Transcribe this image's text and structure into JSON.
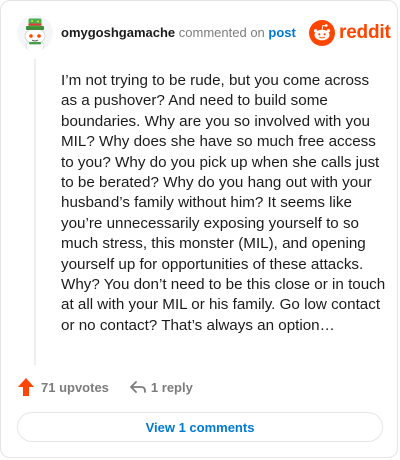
{
  "header": {
    "username": "omygoshgamache",
    "action": "commented on",
    "post_link": "post",
    "brand": "reddit"
  },
  "comment": {
    "body": "I’m not trying to be rude, but you come across as a pushover? And need to build some boundaries. Why are you so involved with you MIL? Why does she have so much free access to you? Why do you pick up when she calls just to be berated? Why do you hang out with your husband’s family without him? It seems like you’re unnecessarily exposing yourself to so much stress, this monster (MIL), and opening yourself up for opportunities of these attacks. Why? You don’t need to be this close or in touch at all with your MIL or his family. Go low contact or no contact? That’s always an option…"
  },
  "actions": {
    "upvotes": "71 upvotes",
    "replies": "1 reply"
  },
  "footer": {
    "view_comments": "View 1 comments"
  },
  "colors": {
    "brand": "#ff4500",
    "link": "#0079d3",
    "text": "#1c1c1c",
    "muted": "#7c7c7c",
    "border": "#e3e5e8"
  },
  "icons": {
    "avatar": "snoo-avatar-green-hat",
    "brand": "reddit-snoo-logo",
    "upvote": "upvote-arrow-icon",
    "reply": "reply-arrow-icon"
  }
}
